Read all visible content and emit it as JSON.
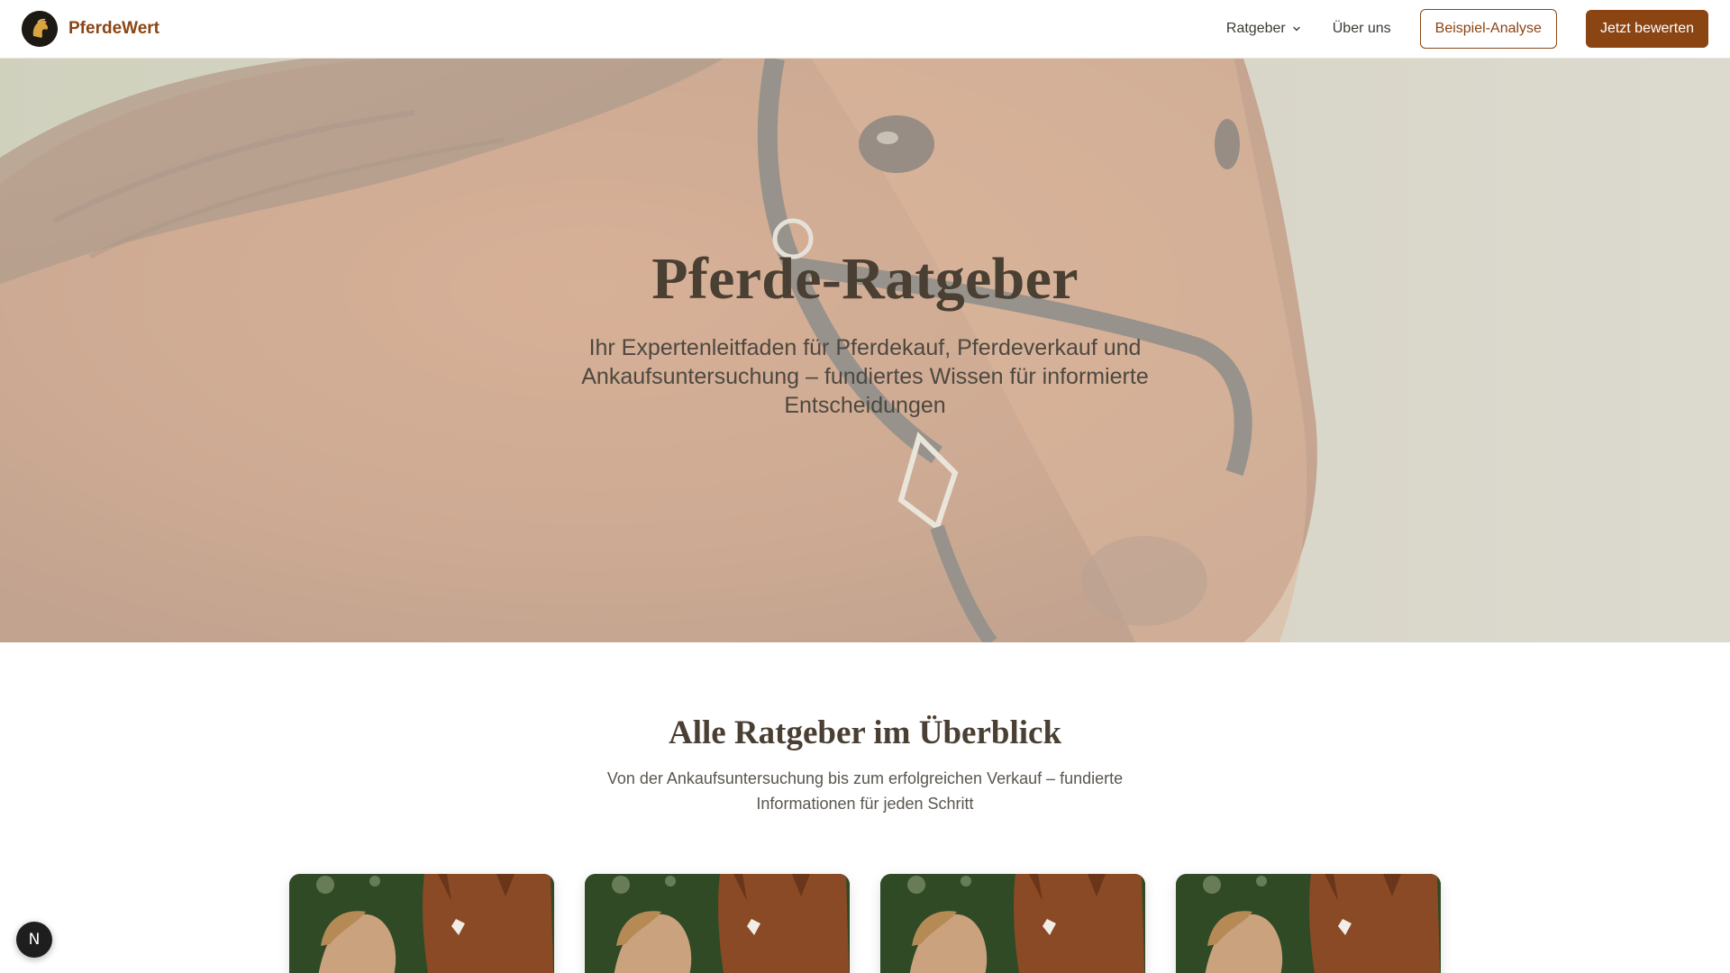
{
  "header": {
    "brand_name": "PferdeWert",
    "nav": {
      "ratgeber": "Ratgeber",
      "about": "Über uns"
    },
    "example_button": "Beispiel-Analyse",
    "cta_button": "Jetzt bewerten"
  },
  "hero": {
    "title": "Pferde-Ratgeber",
    "subtitle": "Ihr Expertenleitfaden für Pferdekauf, Pferdeverkauf und Ankaufsuntersuchung – fundiertes Wissen für informierte Entscheidungen"
  },
  "overview": {
    "title": "Alle Ratgeber im Überblick",
    "subtitle": "Von der Ankaufsuntersuchung bis zum erfolgreichen Verkauf – fundierte Informationen für jeden Schritt"
  },
  "cards": [
    {
      "image": "woman-with-horse-photo"
    },
    {
      "image": "woman-with-horse-photo"
    },
    {
      "image": "woman-with-horse-photo"
    },
    {
      "image": "woman-with-horse-photo"
    }
  ],
  "floating_badge": "N",
  "colors": {
    "brand": "#8b4513",
    "heading": "#4a3f33",
    "text": "#5a5650"
  }
}
